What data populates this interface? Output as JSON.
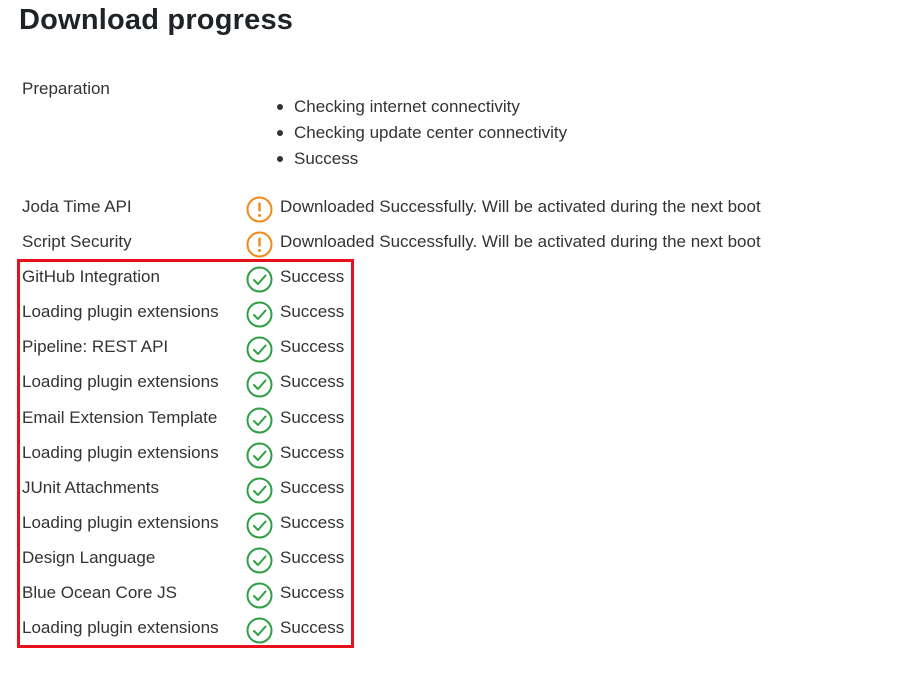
{
  "page": {
    "title": "Download progress"
  },
  "preparation": {
    "label": "Preparation",
    "steps": [
      "Checking internet connectivity",
      "Checking update center connectivity",
      "Success"
    ]
  },
  "colors": {
    "success_icon": "#2ea043",
    "warning_icon": "#f0891b",
    "highlight_border": "#e8111b"
  },
  "plugins": [
    {
      "name": "Joda Time API",
      "status": "Downloaded Successfully. Will be activated during the next boot",
      "icon": "warning-icon"
    },
    {
      "name": "Script Security",
      "status": "Downloaded Successfully. Will be activated during the next boot",
      "icon": "warning-icon"
    },
    {
      "name": "GitHub Integration",
      "status": "Success",
      "icon": "success-check-icon"
    },
    {
      "name": "Loading plugin extensions",
      "status": "Success",
      "icon": "success-check-icon"
    },
    {
      "name": "Pipeline: REST API",
      "status": "Success",
      "icon": "success-check-icon"
    },
    {
      "name": "Loading plugin extensions",
      "status": "Success",
      "icon": "success-check-icon"
    },
    {
      "name": "Email Extension Template",
      "status": "Success",
      "icon": "success-check-icon"
    },
    {
      "name": "Loading plugin extensions",
      "status": "Success",
      "icon": "success-check-icon"
    },
    {
      "name": "JUnit Attachments",
      "status": "Success",
      "icon": "success-check-icon"
    },
    {
      "name": "Loading plugin extensions",
      "status": "Success",
      "icon": "success-check-icon"
    },
    {
      "name": "Design Language",
      "status": "Success",
      "icon": "success-check-icon"
    },
    {
      "name": "Blue Ocean Core JS",
      "status": "Success",
      "icon": "success-check-icon"
    },
    {
      "name": "Loading plugin extensions",
      "status": "Success",
      "icon": "success-check-icon"
    }
  ]
}
